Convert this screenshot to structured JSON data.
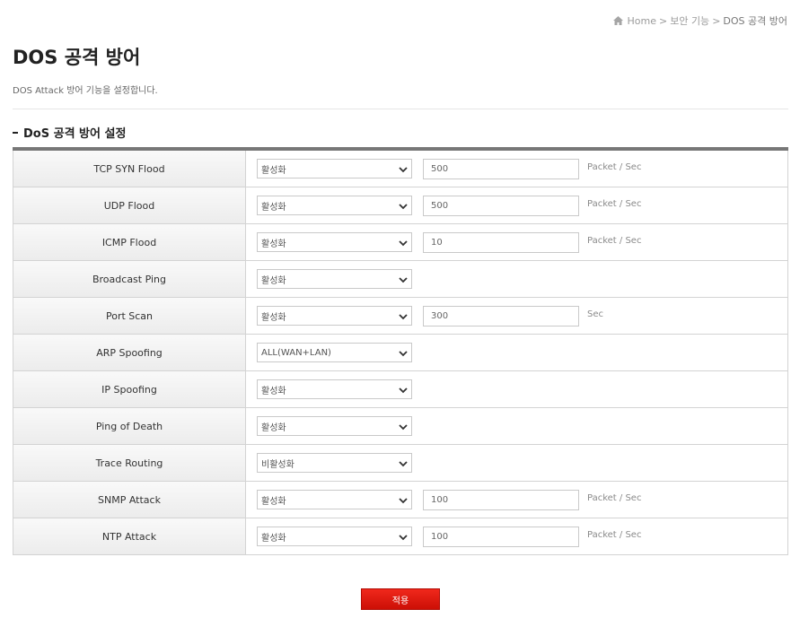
{
  "breadcrumb": {
    "icon": "home-icon",
    "home": "Home",
    "sep1": ">",
    "section": "보안 기능",
    "sep2": ">",
    "current": "DOS 공격 방어"
  },
  "page": {
    "title": "DOS 공격 방어",
    "description": "DOS Attack 방어 기능을 설정합니다."
  },
  "section": {
    "title": "DoS 공격 방어 설정"
  },
  "rows": [
    {
      "label": "TCP SYN Flood",
      "select": "활성화",
      "input": "500",
      "unit": "Packet / Sec"
    },
    {
      "label": "UDP Flood",
      "select": "활성화",
      "input": "500",
      "unit": "Packet / Sec"
    },
    {
      "label": "ICMP Flood",
      "select": "활성화",
      "input": "10",
      "unit": "Packet / Sec"
    },
    {
      "label": "Broadcast Ping",
      "select": "활성화"
    },
    {
      "label": "Port Scan",
      "select": "활성화",
      "input": "300",
      "unit": "Sec"
    },
    {
      "label": "ARP Spoofing",
      "select": "ALL(WAN+LAN)"
    },
    {
      "label": "IP Spoofing",
      "select": "활성화"
    },
    {
      "label": "Ping of Death",
      "select": "활성화"
    },
    {
      "label": "Trace Routing",
      "select": "비활성화"
    },
    {
      "label": "SNMP Attack",
      "select": "활성화",
      "input": "100",
      "unit": "Packet / Sec"
    },
    {
      "label": "NTP Attack",
      "select": "활성화",
      "input": "100",
      "unit": "Packet / Sec"
    }
  ],
  "actions": {
    "apply_label": "적용"
  },
  "colors": {
    "accent": "#e01f14",
    "header_border": "#777777"
  }
}
